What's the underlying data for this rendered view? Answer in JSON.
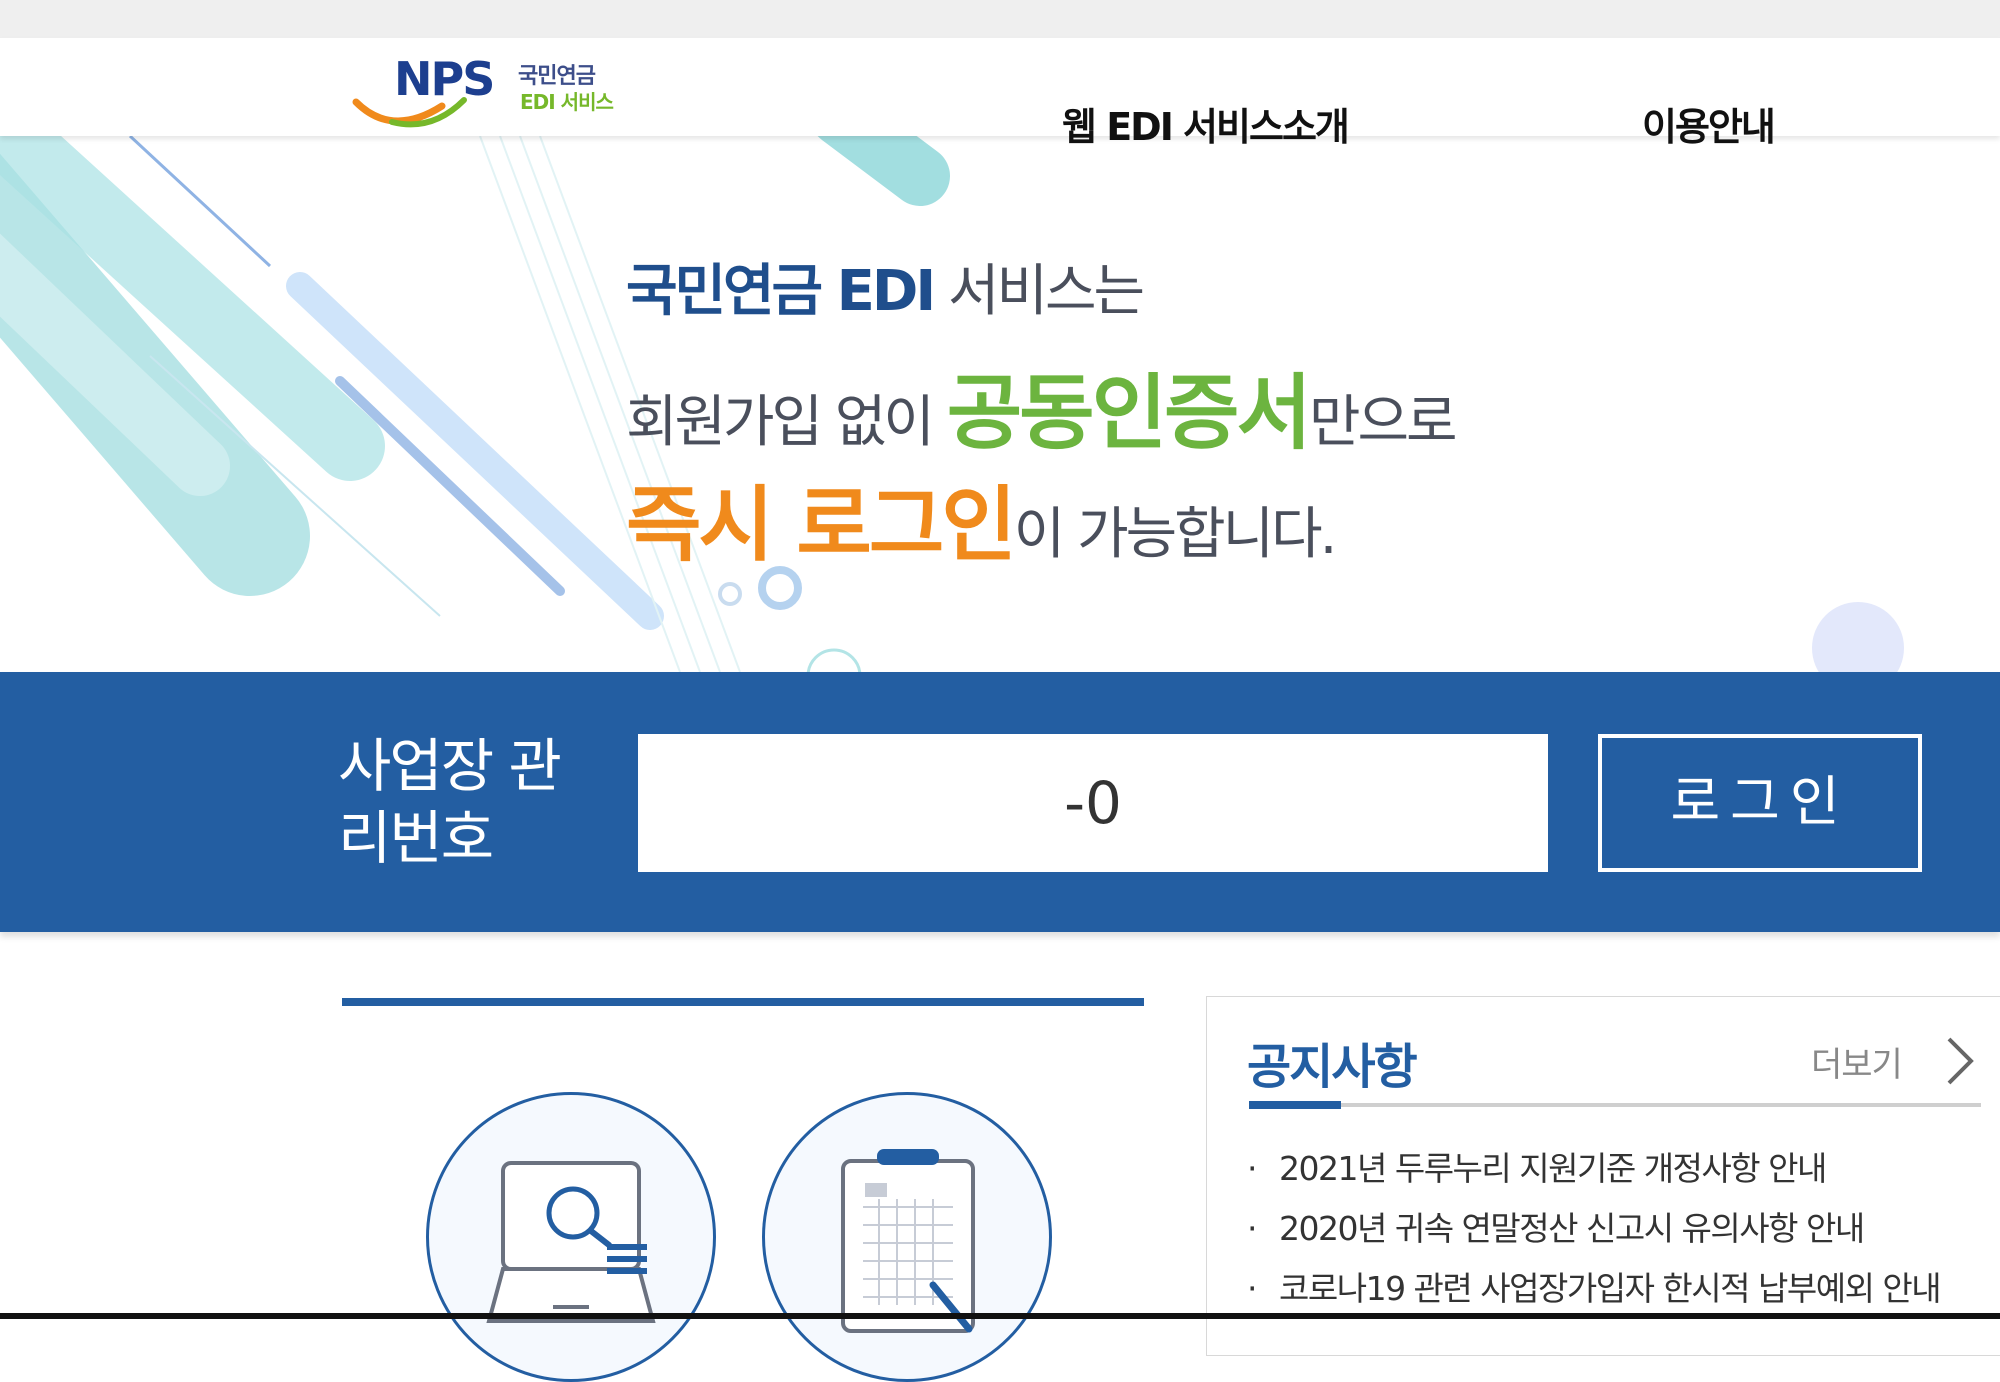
{
  "header": {
    "logo": {
      "main": "NPS",
      "sub1": "국민연금",
      "sub2": "EDI 서비스"
    },
    "nav": [
      "웹 EDI 서비스소개",
      "이용안내"
    ]
  },
  "hero": {
    "line1": {
      "bold": "국민연금 EDI",
      "rest": " 서비스는"
    },
    "line2": {
      "pre": "회원가입 없이 ",
      "highlight": "공동인증서",
      "post": "만으로"
    },
    "line3": {
      "highlight": "즉시 로그인",
      "post": "이 가능합니다."
    }
  },
  "login": {
    "label": "사업장 관리번호",
    "input_value": "-0",
    "button": "로그인"
  },
  "notice": {
    "title": "공지사항",
    "more": "더보기",
    "items": [
      "2021년 두루누리 지원기준 개정사항 안내",
      "2020년 귀속 연말정산 신고시 유의사항 안내",
      "코로나19 관련 사업장가입자 한시적 납부예외 안내"
    ]
  },
  "colors": {
    "brand_blue": "#235ea2",
    "green": "#6cb43f",
    "orange": "#f08a1c"
  },
  "icons": [
    "logo-swoosh-icon",
    "monitor-search-icon",
    "clipboard-calendar-icon",
    "chevron-right-icon"
  ]
}
